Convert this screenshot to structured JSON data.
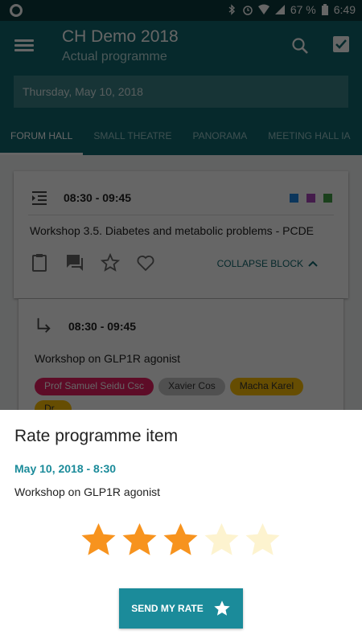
{
  "status_bar": {
    "battery": "67 %",
    "time": "6:49"
  },
  "toolbar": {
    "title": "CH Demo 2018",
    "subtitle": "Actual programme",
    "date": "Thursday, May 10, 2018"
  },
  "tabs": [
    {
      "label": "FORUM HALL",
      "active": true
    },
    {
      "label": "SMALL THEATRE",
      "active": false
    },
    {
      "label": "PANORAMA",
      "active": false
    },
    {
      "label": "MEETING HALL IA",
      "active": false
    }
  ],
  "block": {
    "time": "08:30 - 09:45",
    "title": "Workshop 3.5. Diabetes and metabolic problems - PCDE",
    "collapse_label": "COLLAPSE BLOCK",
    "tag_colors": [
      "#1e88e5",
      "#ab47bc",
      "#43a047"
    ]
  },
  "item": {
    "time": "08:30 - 09:45",
    "title": "Workshop on GLP1R agonist",
    "speakers": [
      {
        "name": "Prof Samuel Seidu Csc",
        "color": "#e91e63"
      },
      {
        "name": "Xavier Cos",
        "color": "#bdbdbd"
      },
      {
        "name": "Macha Karel",
        "color": "#ffc107"
      },
      {
        "name": "Dr...",
        "color": "#ffc107"
      }
    ]
  },
  "sheet": {
    "title": "Rate programme item",
    "date": "May 10, 2018 - 8:30",
    "item": "Workshop on GLP1R agonist",
    "rating": 3,
    "max_rating": 5,
    "star_filled_color": "#f7931e",
    "star_empty_color": "#fdf3cf",
    "send_label": "SEND MY RATE"
  }
}
